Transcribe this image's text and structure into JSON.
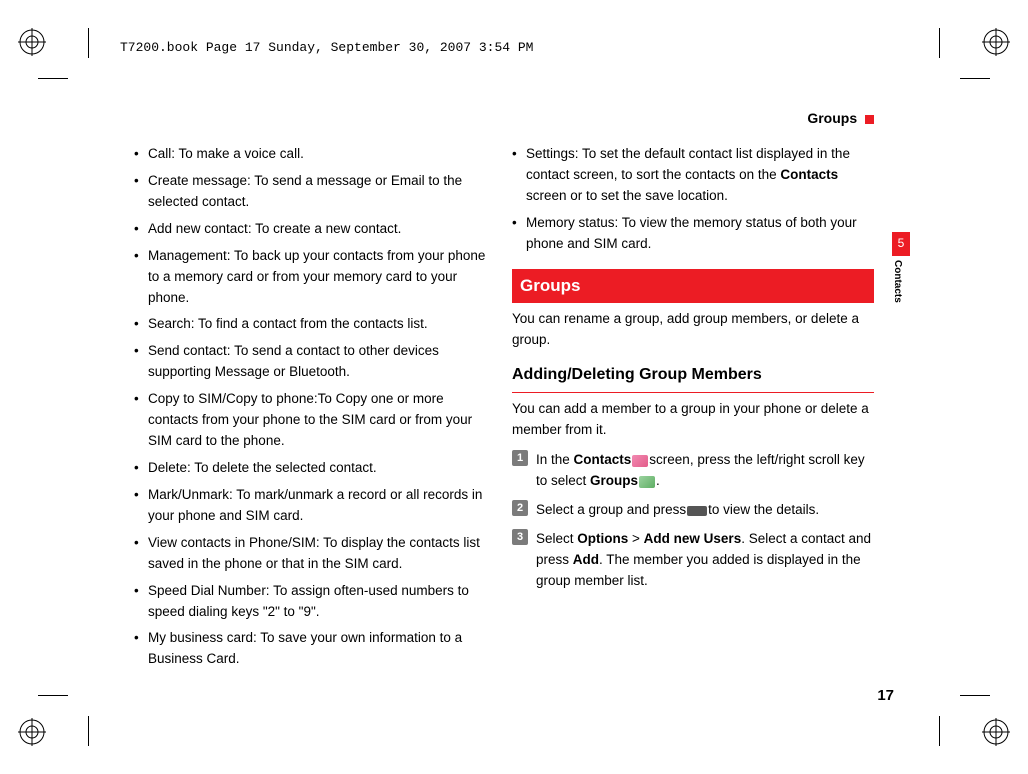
{
  "header_line": "T7200.book  Page 17  Sunday, September 30, 2007  3:54 PM",
  "running_head": "Groups",
  "left_bullets": [
    "Call: To make a voice call.",
    "Create message: To send a message or Email to the selected contact.",
    "Add new contact: To create a new contact.",
    "Management: To back up your contacts from your phone to a memory card or from your memory card to your phone.",
    "Search: To find a contact from the contacts list.",
    "Send contact: To send a contact to other devices supporting Message or Bluetooth.",
    "Copy to SIM/Copy to phone:To Copy one or more contacts from your phone to the SIM card or from your SIM card to the phone.",
    "Delete: To delete the selected contact.",
    "Mark/Unmark: To mark/unmark a record or all records in your phone and SIM card.",
    "View contacts in Phone/SIM: To display the contacts list saved in the phone or that in the SIM card.",
    "Speed Dial Number: To assign often-used numbers to speed dialing keys \"2\" to \"9\".",
    "My business card: To save your own information to a Business Card."
  ],
  "right_bullets_pre": "Settings: To set the default contact list displayed in the contact screen, to sort the contacts on the ",
  "right_bullets_bold": "Contacts",
  "right_bullets_post": " screen or to set the save location.",
  "right_bullet2": "Memory status: To view the memory status of both your phone and SIM card.",
  "section_title": "Groups",
  "section_intro": "You can rename a group, add group members, or delete a group.",
  "subsection_title": "Adding/Deleting Group Members",
  "subsection_intro": "You can add a member to a group in your phone or delete a member from it.",
  "steps": {
    "s1_pre": "In the ",
    "s1_b1": "Contacts",
    "s1_mid": "screen, press the left/right scroll key to select ",
    "s1_b2": "Groups",
    "s1_post": ".",
    "s2_pre": "Select a group and press",
    "s2_post": "to view the details.",
    "s3_pre": "Select ",
    "s3_b1": "Options",
    "s3_gt": " > ",
    "s3_b2": "Add new Users",
    "s3_mid": ". Select a contact and press ",
    "s3_b3": "Add",
    "s3_post": ". The member you added is displayed in the group member list."
  },
  "side_tab_num": "5",
  "side_tab_label": "Contacts",
  "page_number": "17"
}
